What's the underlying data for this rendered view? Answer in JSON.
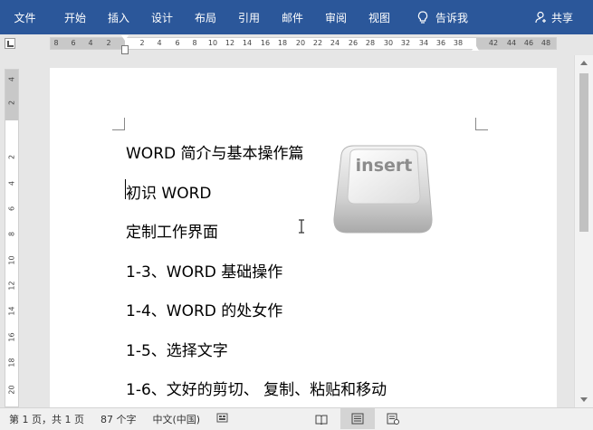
{
  "ribbon": {
    "tabs": [
      "文件",
      "开始",
      "插入",
      "设计",
      "布局",
      "引用",
      "邮件",
      "审阅",
      "视图"
    ],
    "tell_me": "告诉我",
    "share": "共享",
    "color": "#2b579a"
  },
  "ruler": {
    "labels": [
      "8",
      "6",
      "4",
      "2",
      "2",
      "4",
      "6",
      "8",
      "10",
      "12",
      "14",
      "16",
      "18",
      "20",
      "22",
      "24",
      "26",
      "28",
      "30",
      "32",
      "34",
      "36",
      "38",
      "42",
      "44",
      "46",
      "48"
    ],
    "vertical_labels": [
      "4",
      "2",
      "2",
      "4",
      "6",
      "8",
      "10",
      "12",
      "14",
      "16",
      "18",
      "20"
    ]
  },
  "document": {
    "lines": [
      "WORD 简介与基本操作篇",
      "初识 WORD",
      "定制工作界面",
      "1-3、WORD 基础操作",
      "1-4、WORD 的处女作",
      "1-5、选择文字",
      "1-6、文好的剪切、 复制、粘贴和移动"
    ],
    "insert_key_label": "insert"
  },
  "statusbar": {
    "pages": "第 1 页，共 1 页",
    "words": "87 个字",
    "language": "中文(中国)"
  }
}
